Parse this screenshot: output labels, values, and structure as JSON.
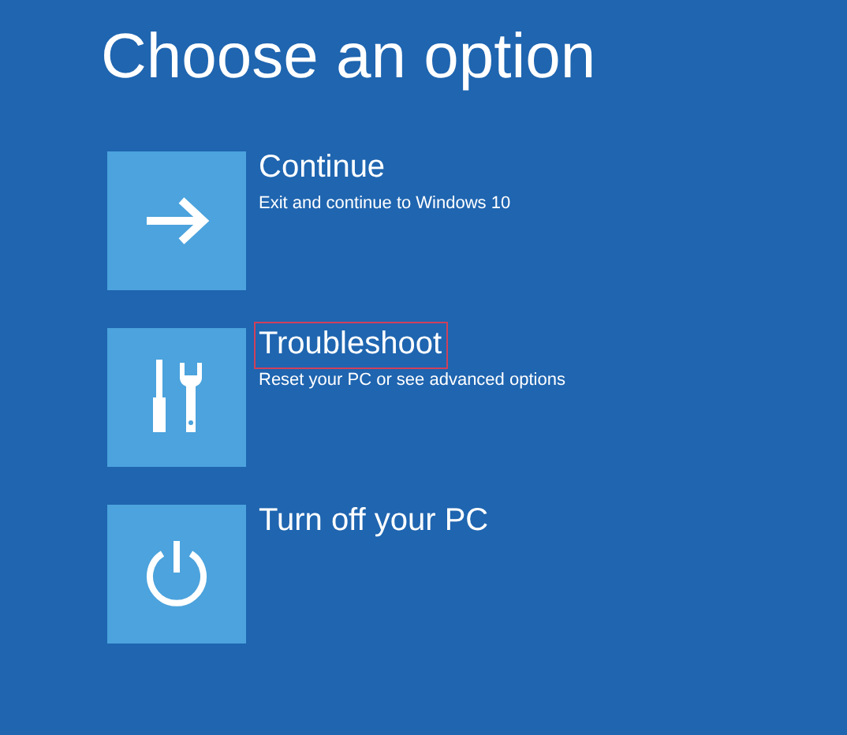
{
  "title": "Choose an option",
  "options": [
    {
      "kind": "arrow",
      "label": "Continue",
      "description": "Exit and continue to Windows 10",
      "highlighted": false
    },
    {
      "kind": "tools",
      "label": "Troubleshoot",
      "description": "Reset your PC or see advanced options",
      "highlighted": true
    },
    {
      "kind": "power",
      "label": "Turn off your PC",
      "highlighted": false
    }
  ]
}
